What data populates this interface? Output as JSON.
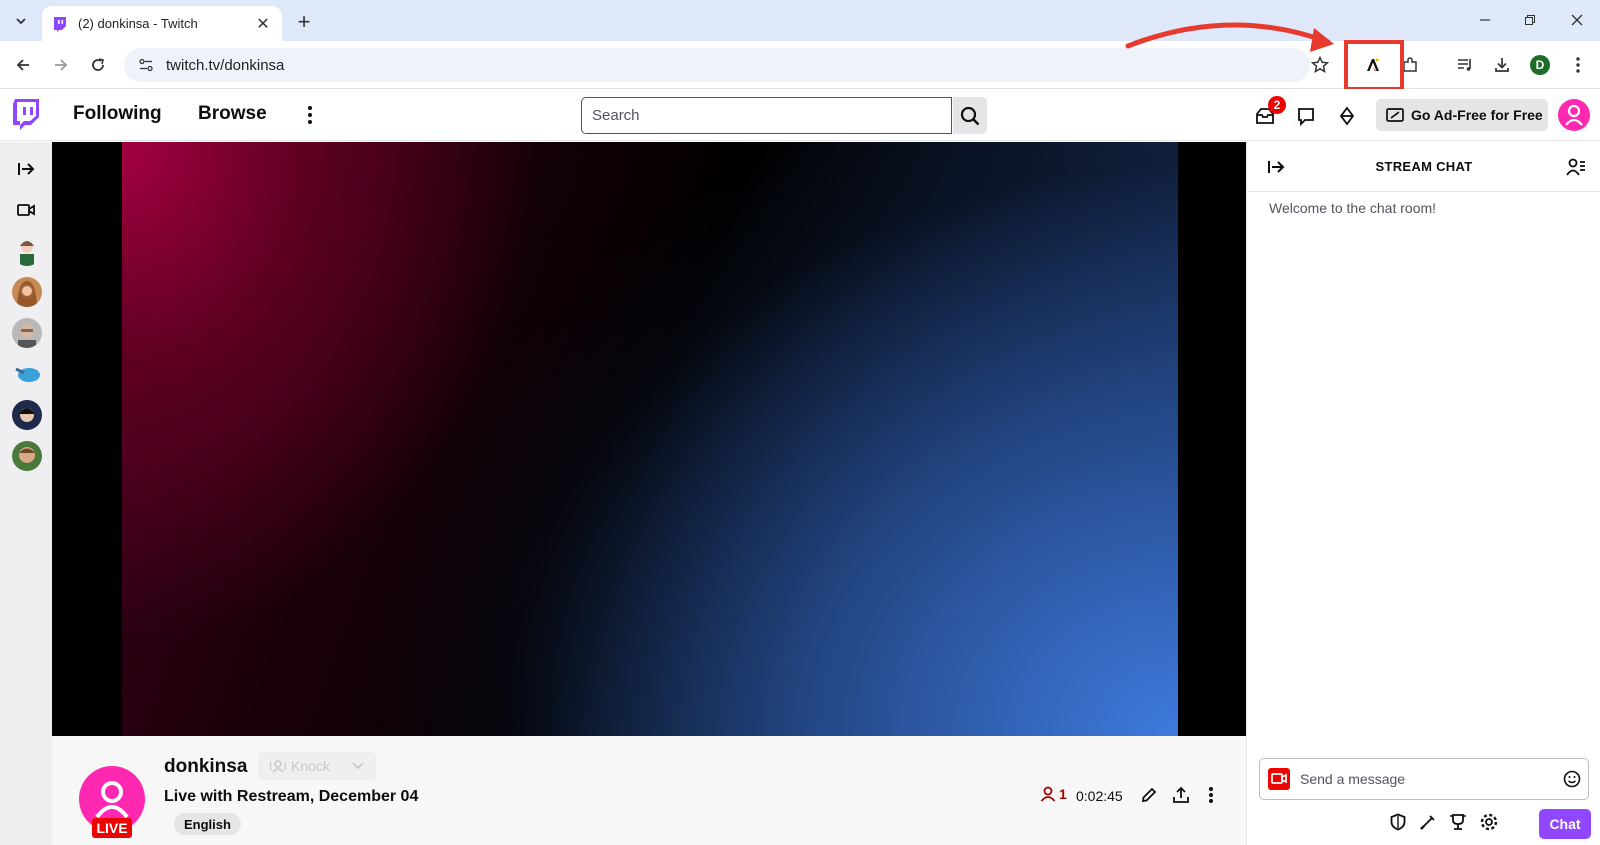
{
  "browser": {
    "tab_title": "(2) donkinsa - Twitch",
    "tab_close": "✕",
    "new_tab": "+",
    "url": "twitch.tv/donkinsa",
    "profile_initial": "D"
  },
  "twitch": {
    "nav": {
      "following": "Following",
      "browse": "Browse",
      "search_placeholder": "Search",
      "inbox_badge": "2",
      "ad_free_label": "Go Ad-Free for Free"
    },
    "channel": {
      "name": "donkinsa",
      "knock_label": "Knock",
      "live_label": "LIVE",
      "stream_title": "Live with Restream, December 04",
      "tag": "English",
      "viewer_count": "1",
      "uptime": "0:02:45"
    },
    "chat": {
      "header": "STREAM CHAT",
      "welcome": "Welcome to the chat room!",
      "input_placeholder": "Send a message",
      "send_label": "Chat"
    }
  },
  "colors": {
    "twitch_purple": "#9147ff",
    "live_red": "#eb0400",
    "avatar_pink": "#ff28b1",
    "annotation_red": "#e8392f"
  }
}
